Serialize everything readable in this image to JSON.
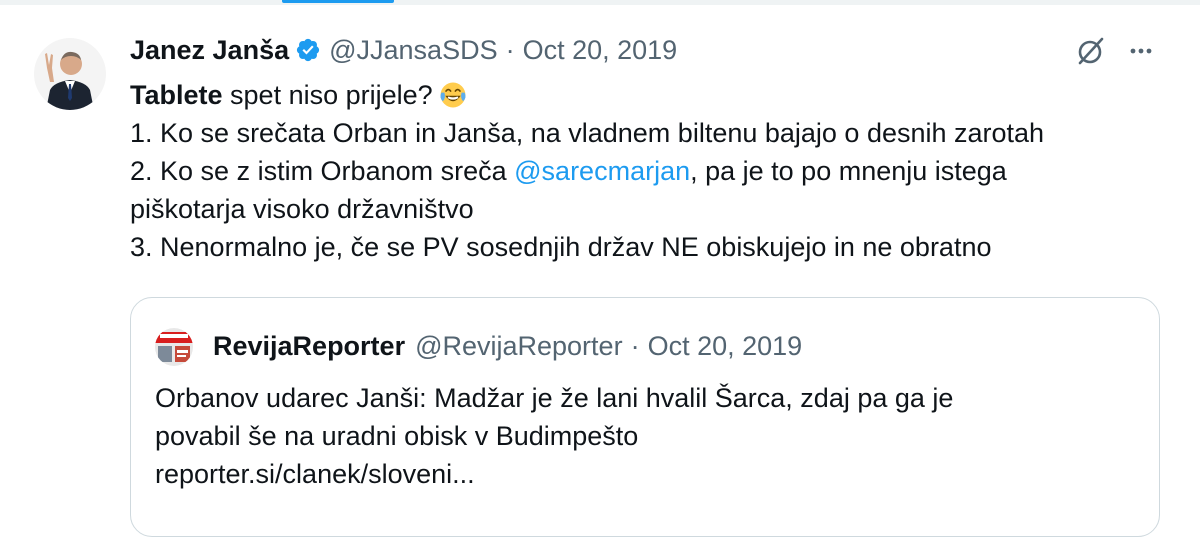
{
  "colors": {
    "text_primary": "#0f1419",
    "text_secondary": "#536471",
    "accent": "#1d9bf0",
    "border": "#cfd9de"
  },
  "tweet": {
    "author": {
      "display_name": "Janez Janša",
      "verified": true,
      "verified_icon": "verified-badge-icon",
      "handle": "@JJansaSDS"
    },
    "separator": "·",
    "date": "Oct 20, 2019",
    "actions": {
      "grok_icon": "grok-icon",
      "more_label": "···"
    },
    "text": {
      "line1_bold": "Tablete",
      "line1_rest": " spet niso prijele?",
      "line1_emoji": "face-with-tears-of-joy-emoji",
      "line2": "1. Ko se srečata Orban in Janša, na vladnem biltenu bajajo o desnih zarotah",
      "line3_before": "2. Ko se z istim Orbanom sreča ",
      "line3_mention": "@sarecmarjan",
      "line3_after": ", pa je to po mnenju istega",
      "line4": "piškotarja visoko državništvo",
      "line5": "3. Nenormalno je, če se PV sosednjih držav NE obiskujejo in ne obratno"
    }
  },
  "quoted_tweet": {
    "author": {
      "display_name": "RevijaReporter",
      "handle": "@RevijaReporter"
    },
    "separator": "·",
    "date": "Oct 20, 2019",
    "text": {
      "line1": "Orbanov udarec Janši: Madžar je že lani hvalil Šarca, zdaj pa ga je",
      "line2": "povabil še na uradni obisk v Budimpešto",
      "line3": "reporter.si/clanek/sloveni..."
    }
  }
}
